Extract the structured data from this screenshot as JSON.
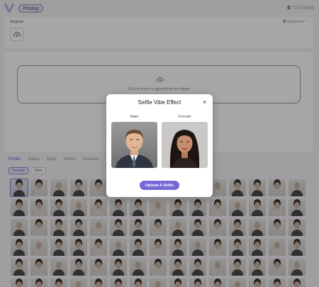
{
  "header": {
    "pricing_label": "Pricing",
    "credits_used": "0",
    "credits_rest": " / 0 Credits"
  },
  "original": {
    "label": "Original",
    "uploaded_count": "0",
    "uploaded_label": " Uploaded"
  },
  "dropzone": {
    "text": "Click to shoot or upload from the album"
  },
  "tabs": [
    "Profile",
    "Status",
    "Baby",
    "Anime",
    "Creative"
  ],
  "chips": [
    "Female",
    "Male"
  ],
  "modal": {
    "title": "Selfie Vibe Effect",
    "close": "×",
    "male_label": "Male",
    "female_label": "Female",
    "upload_label": "Upload A Selfie"
  },
  "colors": {
    "accent": "#7467d6",
    "overlay": "rgba(0,0,0,0.35)"
  },
  "icons": {
    "logo": "v-logo-icon",
    "upload": "cloud-upload-icon",
    "close": "close-icon",
    "chevron": "chevron-up-icon"
  }
}
